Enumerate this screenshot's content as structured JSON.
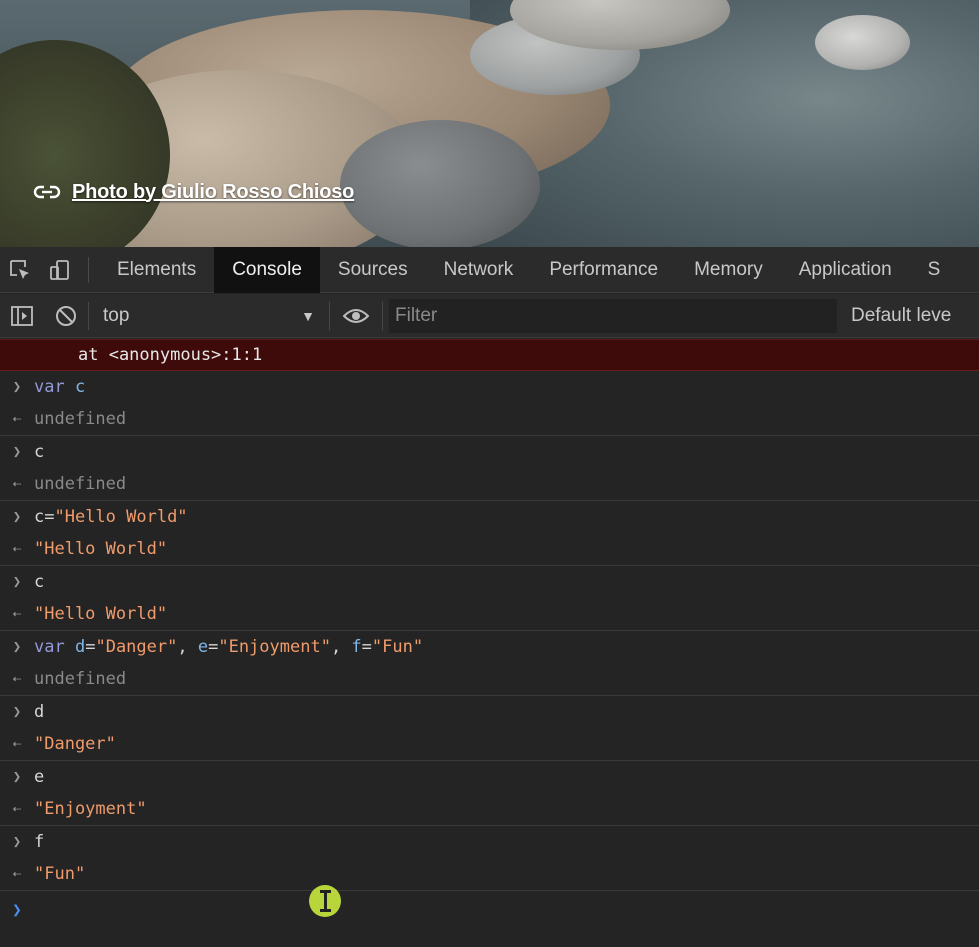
{
  "photo": {
    "credit_text": "Photo by Giulio Rosso Chioso"
  },
  "devtools": {
    "tabs": [
      {
        "label": "Elements",
        "active": false
      },
      {
        "label": "Console",
        "active": true
      },
      {
        "label": "Sources",
        "active": false
      },
      {
        "label": "Network",
        "active": false
      },
      {
        "label": "Performance",
        "active": false
      },
      {
        "label": "Memory",
        "active": false
      },
      {
        "label": "Application",
        "active": false
      },
      {
        "label": "S",
        "active": false
      }
    ],
    "toolbar": {
      "context": "top",
      "filter_placeholder": "Filter",
      "levels": "Default leve"
    }
  },
  "console": {
    "error_tail": "at <anonymous>:1:1",
    "entries": [
      {
        "input": "var c",
        "output": "undefined"
      },
      {
        "input": "c",
        "output": "undefined"
      },
      {
        "input": "c=\"Hello World\"",
        "output": "\"Hello World\""
      },
      {
        "input": "c",
        "output": "\"Hello World\""
      },
      {
        "input": "var d=\"Danger\", e=\"Enjoyment\", f=\"Fun\"",
        "output": "undefined"
      },
      {
        "input": "d",
        "output": "\"Danger\""
      },
      {
        "input": "e",
        "output": "\"Enjoyment\""
      },
      {
        "input": "f",
        "output": "\"Fun\""
      }
    ],
    "input_marker": ">",
    "output_marker": "<·"
  },
  "colors": {
    "accent_active_tab": "#111111",
    "string": "#f09b6b",
    "keyword": "#9399d6",
    "variable": "#7fb6e6",
    "error_bg": "#3e0a0a",
    "prompt": "#4b8ff5",
    "cursor": "#b8d53b"
  }
}
